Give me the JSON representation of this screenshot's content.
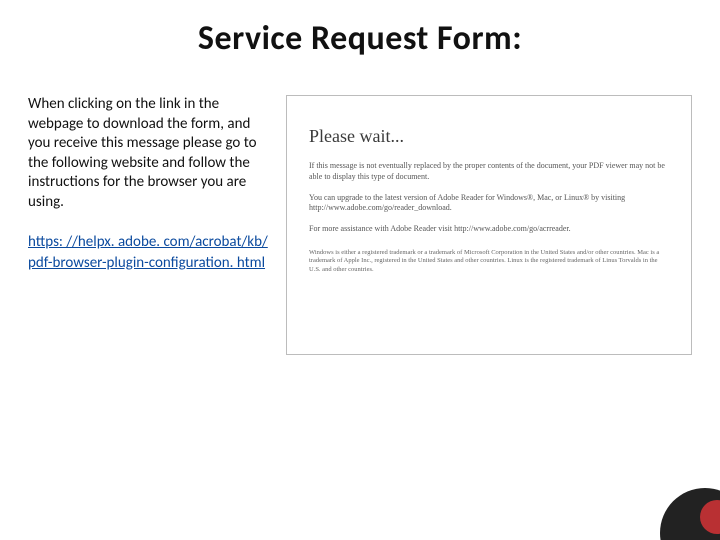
{
  "title": "Service Request Form:",
  "left": {
    "instruction": "When clicking on the link in the webpage to download the form, and you receive this message please go to the following website and follow the instructions for the browser you are using.",
    "link_text": "https: //helpx. adobe. com/acrobat/kb/pdf-browser-plugin-configuration. html",
    "link_href": "https://helpx.adobe.com/acrobat/kb/pdf-browser-plugin-configuration.html"
  },
  "pdf": {
    "heading": "Please wait...",
    "para1": "If this message is not eventually replaced by the proper contents of the document, your PDF viewer may not be able to display this type of document.",
    "para2": "You can upgrade to the latest version of Adobe Reader for Windows®, Mac, or Linux® by visiting  http://www.adobe.com/go/reader_download.",
    "para3": "For more assistance with Adobe Reader visit  http://www.adobe.com/go/acrreader.",
    "fineprint": "Windows is either a registered trademark or a trademark of Microsoft Corporation in the United States and/or other countries. Mac is a trademark of Apple Inc., registered in the United States and other countries. Linux is the registered trademark of Linus Torvalds in the U.S. and other countries."
  }
}
